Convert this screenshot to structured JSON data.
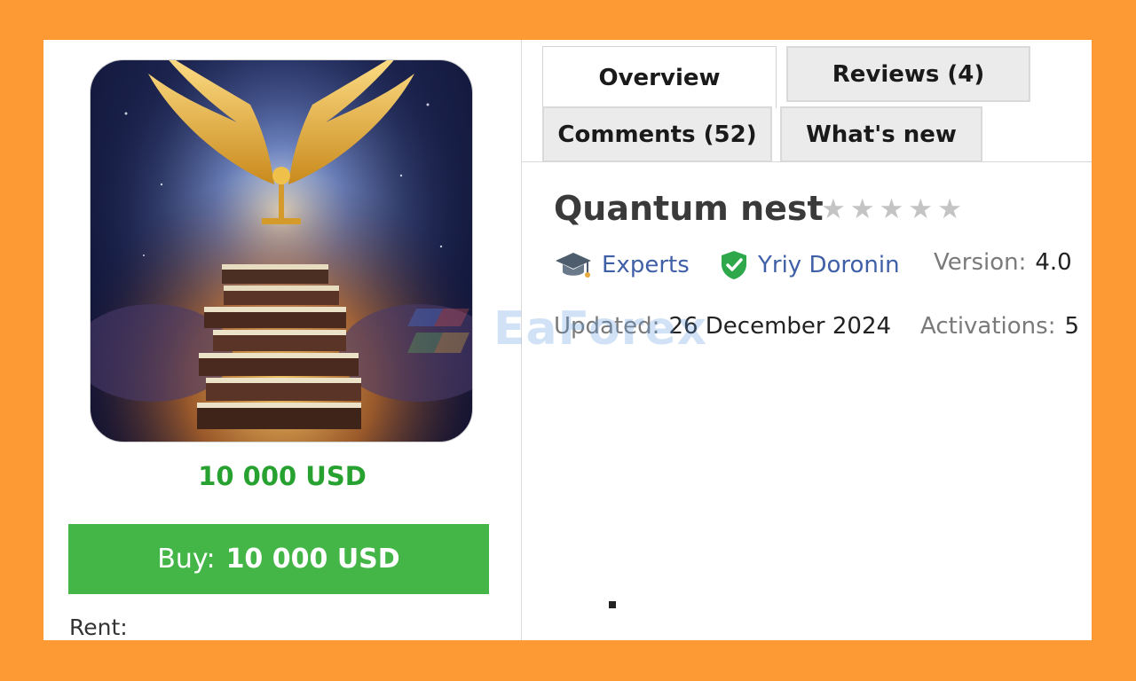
{
  "product": {
    "price_display": "10 000 USD",
    "buy_label": "Buy:",
    "buy_amount": "10 000 USD",
    "rent_label": "Rent:",
    "title": "Quantum nest",
    "rating_stars": 0,
    "rating_max": 5
  },
  "tabs": [
    {
      "label": "Overview",
      "active": true
    },
    {
      "label": "Reviews (4)",
      "active": false
    },
    {
      "label": "Comments (52)",
      "active": false
    },
    {
      "label": "What's new",
      "active": false
    }
  ],
  "meta": {
    "category": "Experts",
    "author": "Yriy Doronin",
    "version_label": "Version:",
    "version_value": "4.0",
    "updated_label": "Updated:",
    "updated_value": "26 December 2024",
    "activations_label": "Activations:",
    "activations_value": "5"
  },
  "watermark": {
    "text": "EaForex"
  },
  "icons": {
    "category": "graduation-cap-icon",
    "author": "verified-shield-icon",
    "rating": "star-icon"
  },
  "colors": {
    "frame": "#fd9a33",
    "price": "#27a12f",
    "buy_button": "#43b647",
    "link": "#3f5fa7",
    "verified": "#2ea84a"
  }
}
